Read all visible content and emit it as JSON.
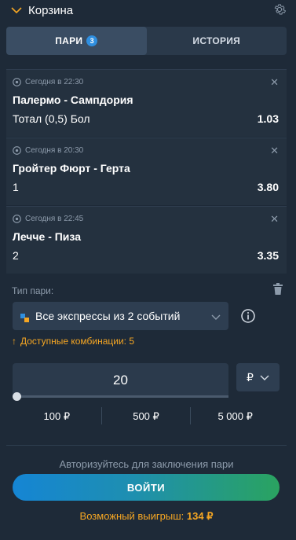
{
  "header": {
    "title": "Корзина"
  },
  "tabs": [
    {
      "label": "ПАРИ",
      "count": "3",
      "active": true
    },
    {
      "label": "ИСТОРИЯ",
      "active": false
    }
  ],
  "bets": [
    {
      "time": "Сегодня в 22:30",
      "match": "Палермо - Сампдория",
      "outcome": "Тотал (0,5) Бол",
      "odds": "1.03"
    },
    {
      "time": "Сегодня в 20:30",
      "match": "Гройтер Фюрт - Герта",
      "outcome": "1",
      "odds": "3.80"
    },
    {
      "time": "Сегодня в 22:45",
      "match": "Лечче - Пиза",
      "outcome": "2",
      "odds": "3.35"
    }
  ],
  "bet_type": {
    "label": "Тип пари:",
    "selected": "Все экспрессы из 2 событий",
    "combinations": "Доступные комбинации: 5"
  },
  "amount": {
    "value": "20",
    "currency": "₽",
    "quick": [
      "100 ₽",
      "500 ₽",
      "5 000 ₽"
    ]
  },
  "footer": {
    "auth_text": "Авторизуйтесь для заключения пари",
    "login_label": "ВОЙТИ",
    "win_label": "Возможный выигрыш:",
    "win_value": "134 ₽"
  },
  "colors": {
    "background": "#1e2a38",
    "accent_orange": "#f5a623",
    "accent_blue": "#2f8fe0",
    "button_gradient_start": "#1585d4",
    "button_gradient_end": "#2aa360"
  },
  "icons": [
    "chevron-down-icon",
    "gear-icon",
    "soccer-ball-icon",
    "close-icon",
    "trash-icon",
    "express-icon",
    "info-icon",
    "arrow-up-icon"
  ]
}
